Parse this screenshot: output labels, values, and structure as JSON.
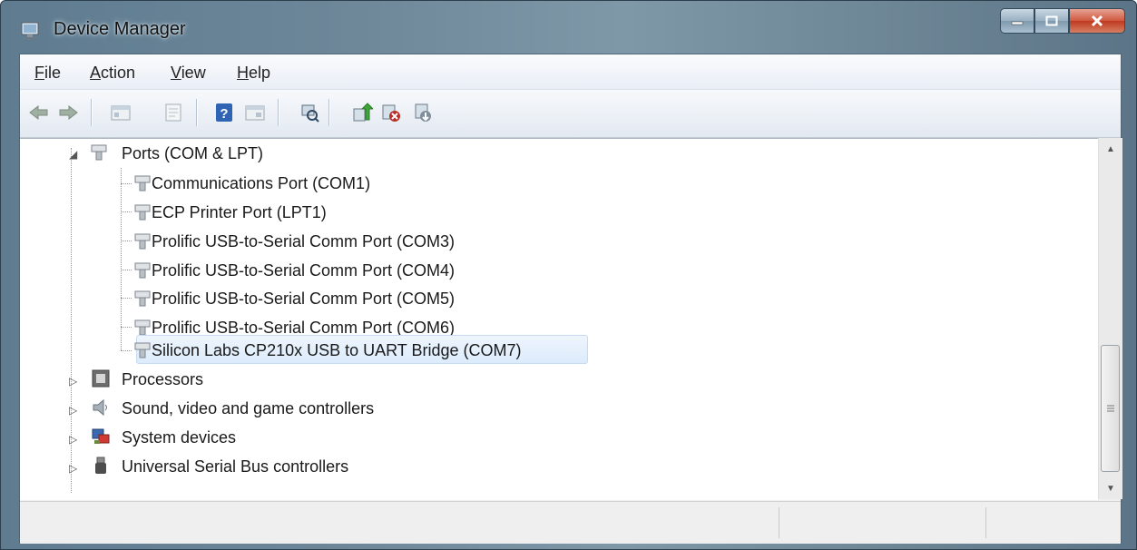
{
  "window": {
    "title": "Device Manager"
  },
  "menu": {
    "file": "File",
    "action": "Action",
    "view": "View",
    "help": "Help"
  },
  "toolbar": {
    "buttons": [
      "back-icon",
      "forward-icon",
      "show-hide-tree-icon",
      "properties-icon",
      "help-icon",
      "view-icon",
      "scan-hardware-icon",
      "update-driver-icon",
      "disable-device-icon",
      "uninstall-device-icon"
    ]
  },
  "tree": {
    "ports": {
      "label": "Ports (COM & LPT)",
      "expanded": true
    },
    "port_children": [
      "Communications Port (COM1)",
      "ECP Printer Port (LPT1)",
      "Prolific USB-to-Serial Comm Port (COM3)",
      "Prolific USB-to-Serial Comm Port (COM4)",
      "Prolific USB-to-Serial Comm Port (COM5)",
      "Prolific USB-to-Serial Comm Port (COM6)",
      "Silicon Labs CP210x USB to UART Bridge (COM7)"
    ],
    "selected": "Silicon Labs CP210x USB to UART Bridge (COM7)",
    "categories": [
      "Processors",
      "Sound, video and game controllers",
      "System devices",
      "Universal Serial Bus controllers"
    ]
  },
  "colors": {
    "selection": "#dcebfc",
    "selection_border": "#c6dbf2",
    "close_button": "#c8452b"
  }
}
